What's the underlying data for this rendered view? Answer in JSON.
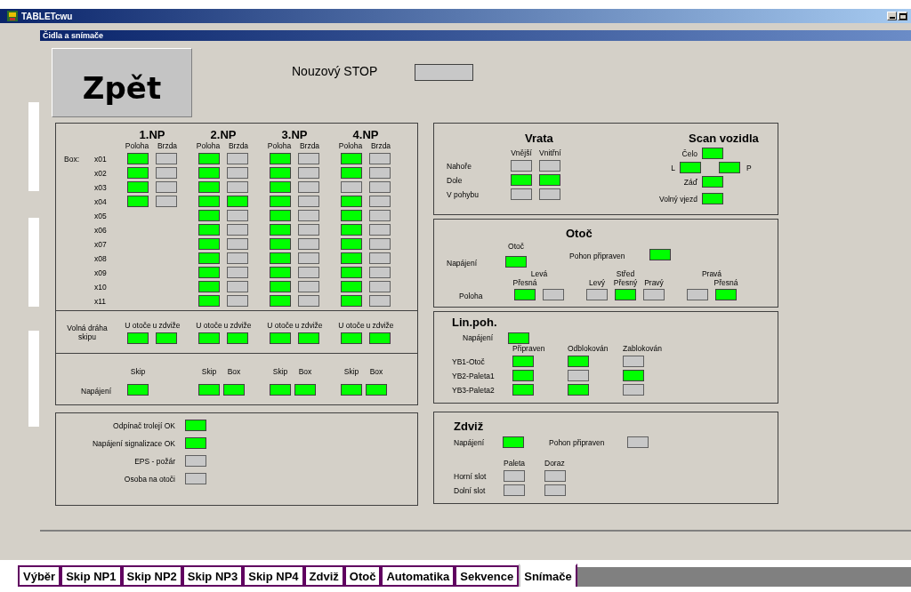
{
  "window": {
    "title": "TABLETcwu"
  },
  "subwindow": {
    "title": "Čidla a snímače"
  },
  "back_button": "Zpět",
  "emergency_stop": {
    "label": "Nouzový STOP",
    "on": false
  },
  "np": {
    "box_label": "Box:",
    "row_labels": [
      "x01",
      "x02",
      "x03",
      "x04",
      "x05",
      "x06",
      "x07",
      "x08",
      "x09",
      "x10",
      "x11"
    ],
    "floors": [
      {
        "name": "1.NP",
        "columns": [
          "Poloha",
          "Brzda"
        ],
        "boxes": [
          [
            true,
            false
          ],
          [
            true,
            false
          ],
          [
            true,
            false
          ],
          [
            true,
            false
          ]
        ]
      },
      {
        "name": "2.NP",
        "columns": [
          "Poloha",
          "Brzda"
        ],
        "boxes": [
          [
            true,
            false
          ],
          [
            true,
            false
          ],
          [
            true,
            false
          ],
          [
            true,
            true
          ],
          [
            true,
            false
          ],
          [
            true,
            false
          ],
          [
            true,
            false
          ],
          [
            true,
            false
          ],
          [
            true,
            false
          ],
          [
            true,
            false
          ],
          [
            true,
            false
          ]
        ]
      },
      {
        "name": "3.NP",
        "columns": [
          "Poloha",
          "Brzda"
        ],
        "boxes": [
          [
            true,
            false
          ],
          [
            true,
            false
          ],
          [
            true,
            false
          ],
          [
            true,
            false
          ],
          [
            true,
            false
          ],
          [
            true,
            false
          ],
          [
            true,
            false
          ],
          [
            true,
            false
          ],
          [
            true,
            false
          ],
          [
            true,
            false
          ],
          [
            true,
            false
          ]
        ]
      },
      {
        "name": "4.NP",
        "columns": [
          "Poloha",
          "Brzda"
        ],
        "boxes": [
          [
            true,
            false
          ],
          [
            true,
            false
          ],
          [
            false,
            false
          ],
          [
            true,
            false
          ],
          [
            true,
            false
          ],
          [
            true,
            false
          ],
          [
            true,
            false
          ],
          [
            true,
            false
          ],
          [
            true,
            false
          ],
          [
            true,
            false
          ],
          [
            true,
            false
          ]
        ]
      }
    ],
    "free_path": {
      "label": "Volná dráha skipu",
      "floors": [
        [
          {
            "label": "U otoče",
            "on": true
          },
          {
            "label": "u zdviže",
            "on": true
          }
        ],
        [
          {
            "label": "U otoče",
            "on": true
          },
          {
            "label": "u zdviže",
            "on": true
          }
        ],
        [
          {
            "label": "U otoče",
            "on": true
          },
          {
            "label": "u zdviže",
            "on": true
          }
        ],
        [
          {
            "label": "U otoče",
            "on": true
          },
          {
            "label": "u zdviže",
            "on": true
          }
        ]
      ]
    },
    "power": {
      "label": "Napájení",
      "floors": [
        [
          {
            "label": "Skip",
            "on": true
          }
        ],
        [
          {
            "label": "Skip",
            "on": true
          },
          {
            "label": "Box",
            "on": true
          }
        ],
        [
          {
            "label": "Skip",
            "on": true
          },
          {
            "label": "Box",
            "on": true
          }
        ],
        [
          {
            "label": "Skip",
            "on": true
          },
          {
            "label": "Box",
            "on": true
          }
        ]
      ]
    }
  },
  "general": [
    {
      "label": "Odpínač trolejí OK",
      "on": true
    },
    {
      "label": "Napájení signalizace OK",
      "on": true
    },
    {
      "label": "EPS - požár",
      "on": false
    },
    {
      "label": "Osoba na otoči",
      "on": false
    }
  ],
  "gates": {
    "title": "Vrata",
    "columns": [
      "Vnější",
      "Vnitřní"
    ],
    "rows": [
      {
        "label": "Nahoře",
        "states": [
          false,
          false
        ]
      },
      {
        "label": "Dole",
        "states": [
          true,
          true
        ]
      },
      {
        "label": "V pohybu",
        "states": [
          false,
          false
        ]
      }
    ]
  },
  "vehicle_scan": {
    "title": "Scan vozidla",
    "front": {
      "label": "Čelo",
      "on": true
    },
    "left": {
      "label": "L",
      "on": true
    },
    "right": {
      "label": "P",
      "on": true
    },
    "rear": {
      "label": "Záď",
      "on": true
    },
    "free_entry": {
      "label": "Volný vjezd",
      "on": true
    }
  },
  "turntable": {
    "title": "Otoč",
    "power": {
      "label": "Napájení",
      "column": "Otoč",
      "on": true
    },
    "drive_ready": {
      "label": "Pohon připraven",
      "on": true
    },
    "position_label": "Poloha",
    "groups": [
      {
        "title": "Levá",
        "items": [
          {
            "label": "Přesná",
            "on": true
          },
          {
            "on": false
          }
        ]
      },
      {
        "title": "Střed",
        "items": [
          {
            "label": "Levý",
            "on": false
          },
          {
            "label": "Přesný",
            "on": true
          },
          {
            "label": "Pravý",
            "on": false
          }
        ]
      },
      {
        "title": "Pravá",
        "items": [
          {
            "on": false
          },
          {
            "label": "Přesná",
            "on": true
          }
        ]
      }
    ]
  },
  "linear_drive": {
    "title": "Lin.poh.",
    "power": {
      "label": "Napájení",
      "on": true
    },
    "columns": [
      "Připraven",
      "Odblokován",
      "Zablokován"
    ],
    "rows": [
      {
        "label": "YB1-Otoč",
        "states": [
          true,
          true,
          false
        ]
      },
      {
        "label": "YB2-Paleta1",
        "states": [
          true,
          false,
          true
        ]
      },
      {
        "label": "YB3-Paleta2",
        "states": [
          true,
          true,
          false
        ]
      }
    ]
  },
  "lift": {
    "title": "Zdviž",
    "power": {
      "label": "Napájení",
      "on": true
    },
    "drive_ready": {
      "label": "Pohon připraven",
      "on": false
    },
    "columns": [
      "Paleta",
      "Doraz"
    ],
    "rows": [
      {
        "label": "Horní slot",
        "states": [
          false,
          false
        ]
      },
      {
        "label": "Dolní slot",
        "states": [
          false,
          false
        ]
      }
    ]
  },
  "tabs": [
    {
      "label": "Výběr",
      "selected": false
    },
    {
      "label": "Skip NP1",
      "selected": false
    },
    {
      "label": "Skip NP2",
      "selected": false
    },
    {
      "label": "Skip NP3",
      "selected": false
    },
    {
      "label": "Skip NP4",
      "selected": false
    },
    {
      "label": "Zdviž",
      "selected": false
    },
    {
      "label": "Otoč",
      "selected": false
    },
    {
      "label": "Automatika",
      "selected": false
    },
    {
      "label": "Sekvence",
      "selected": false
    },
    {
      "label": "Snímače",
      "selected": true
    }
  ]
}
